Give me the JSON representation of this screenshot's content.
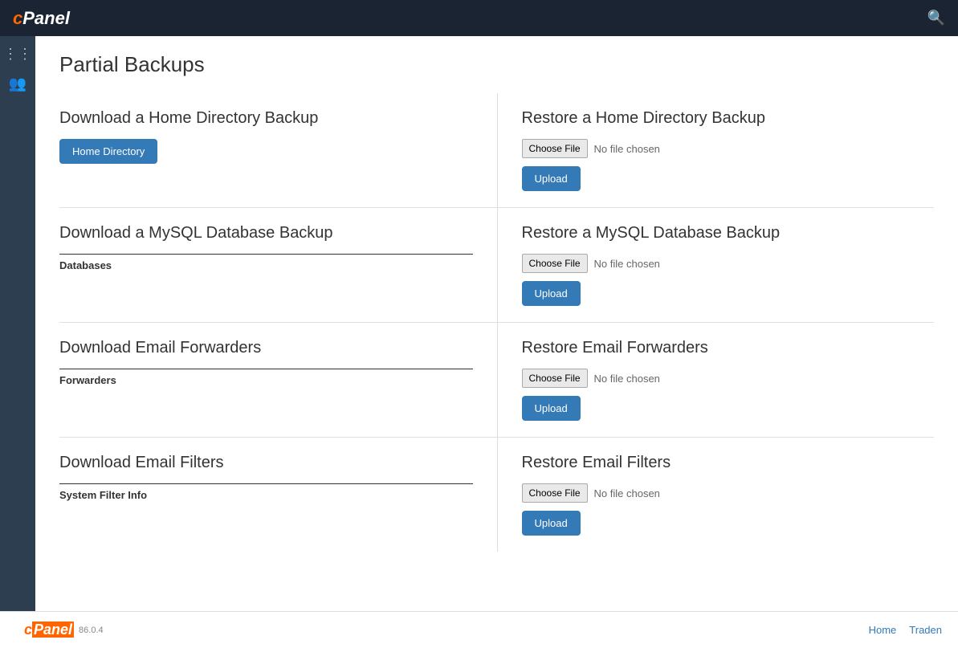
{
  "navbar": {
    "brand": "cPanel",
    "search_icon": "🔍"
  },
  "sidebar": {
    "icons": [
      "grid-icon",
      "users-icon"
    ]
  },
  "page": {
    "title": "Partial Backups"
  },
  "sections": [
    {
      "id": "home-dir-download",
      "title": "Download a Home Directory Backup",
      "button_label": "Home Directory",
      "side": "left"
    },
    {
      "id": "home-dir-restore",
      "title": "Restore a Home Directory Backup",
      "file_label": "Choose File",
      "no_file": "No file chosen",
      "upload_label": "Upload",
      "side": "right"
    },
    {
      "id": "mysql-download",
      "title": "Download a MySQL Database Backup",
      "table_header": "Databases",
      "side": "left"
    },
    {
      "id": "mysql-restore",
      "title": "Restore a MySQL Database Backup",
      "file_label": "Choose File",
      "no_file": "No file chosen",
      "upload_label": "Upload",
      "side": "right"
    },
    {
      "id": "forwarders-download",
      "title": "Download Email Forwarders",
      "table_header": "Forwarders",
      "side": "left"
    },
    {
      "id": "forwarders-restore",
      "title": "Restore Email Forwarders",
      "file_label": "Choose File",
      "no_file": "No file chosen",
      "upload_label": "Upload",
      "side": "right"
    },
    {
      "id": "filters-download",
      "title": "Download Email Filters",
      "table_header": "System Filter Info",
      "side": "left"
    },
    {
      "id": "filters-restore",
      "title": "Restore Email Filters",
      "file_label": "Choose File",
      "no_file": "No file chosen",
      "upload_label": "Upload",
      "side": "right"
    }
  ],
  "footer": {
    "brand": "cPanel",
    "version": "86.0.4",
    "links": [
      "Home",
      "Traden"
    ]
  }
}
